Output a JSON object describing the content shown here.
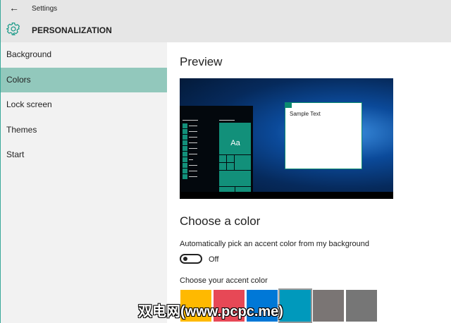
{
  "header": {
    "back": "←",
    "title": "Settings",
    "section": "PERSONALIZATION"
  },
  "sidebar": {
    "items": [
      {
        "label": "Background"
      },
      {
        "label": "Colors"
      },
      {
        "label": "Lock screen"
      },
      {
        "label": "Themes"
      },
      {
        "label": "Start"
      }
    ]
  },
  "main": {
    "preview_title": "Preview",
    "sample_text": "Sample Text",
    "tile_text": "Aa",
    "choose_title": "Choose a color",
    "auto_label": "Automatically pick an accent color from my background",
    "toggle_state": "Off",
    "accent_label": "Choose your accent color",
    "swatches": [
      "#FFB900",
      "#E74856",
      "#0078D7",
      "#0099BC",
      "#7A7574",
      "#767676"
    ],
    "selected_swatch": 3
  },
  "watermark": "双电网(www.pcpc.me)"
}
